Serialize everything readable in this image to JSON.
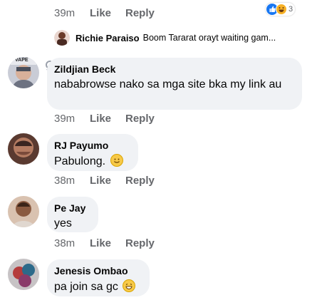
{
  "top_comment": {
    "time": "39m",
    "like_label": "Like",
    "reply_label": "Reply",
    "reaction_count": "3"
  },
  "reply_preview": {
    "author": "Richie Paraiso",
    "text": "Boom Tararat orayt waiting gam..."
  },
  "comments": [
    {
      "author": "Zildjian Beck",
      "text": "nababrowse nako sa mga site bka my link au",
      "time": "39m",
      "like_label": "Like",
      "reply_label": "Reply",
      "avatar_caption": "VAPE"
    },
    {
      "author": "RJ Payumo",
      "text": "Pabulong.",
      "time": "38m",
      "like_label": "Like",
      "reply_label": "Reply"
    },
    {
      "author": "Pe Jay",
      "text": "yes",
      "time": "38m",
      "like_label": "Like",
      "reply_label": "Reply"
    },
    {
      "author": "Jenesis Ombao",
      "text": "pa join sa gc",
      "time": "",
      "like_label": "",
      "reply_label": ""
    }
  ],
  "colors": {
    "bubble": "#f0f2f5",
    "meta_text": "#65676b",
    "like_reaction": "#1877f2",
    "haha_reaction": "#f7b125"
  },
  "icons": [
    "like-reaction-icon",
    "haha-reaction-icon",
    "smile-emoji-icon",
    "grin-emoji-icon"
  ]
}
